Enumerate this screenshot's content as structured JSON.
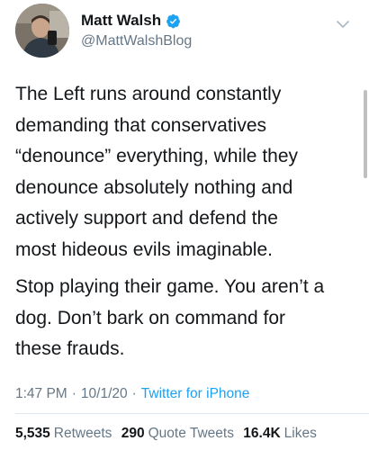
{
  "author": {
    "display_name": "Matt Walsh",
    "handle": "@MattWalshBlog",
    "verified_icon": "verified-badge-icon",
    "avatar": "profile-photo"
  },
  "tweet": {
    "paragraphs": [
      "The Left runs around constantly\ndemanding that conservatives\n“denounce” everything, while they\ndenounce absolutely nothing and\nactively support and defend the\nmost hideous evils imaginable.",
      "Stop playing their game. You aren’t a\ndog. Don’t bark on command for\nthese frauds."
    ]
  },
  "meta": {
    "time": "1:47 PM",
    "date": "10/1/20",
    "separator": "·",
    "source": "Twitter for iPhone"
  },
  "stats": {
    "retweets_count": "5,535",
    "retweets_label": "Retweets",
    "quote_tweets_count": "290",
    "quote_tweets_label": "Quote Tweets",
    "likes_count": "16.4K",
    "likes_label": "Likes"
  },
  "colors": {
    "text": "#14171a",
    "secondary": "#657786",
    "accent": "#1da1f2",
    "divider": "#e1e8ed"
  }
}
